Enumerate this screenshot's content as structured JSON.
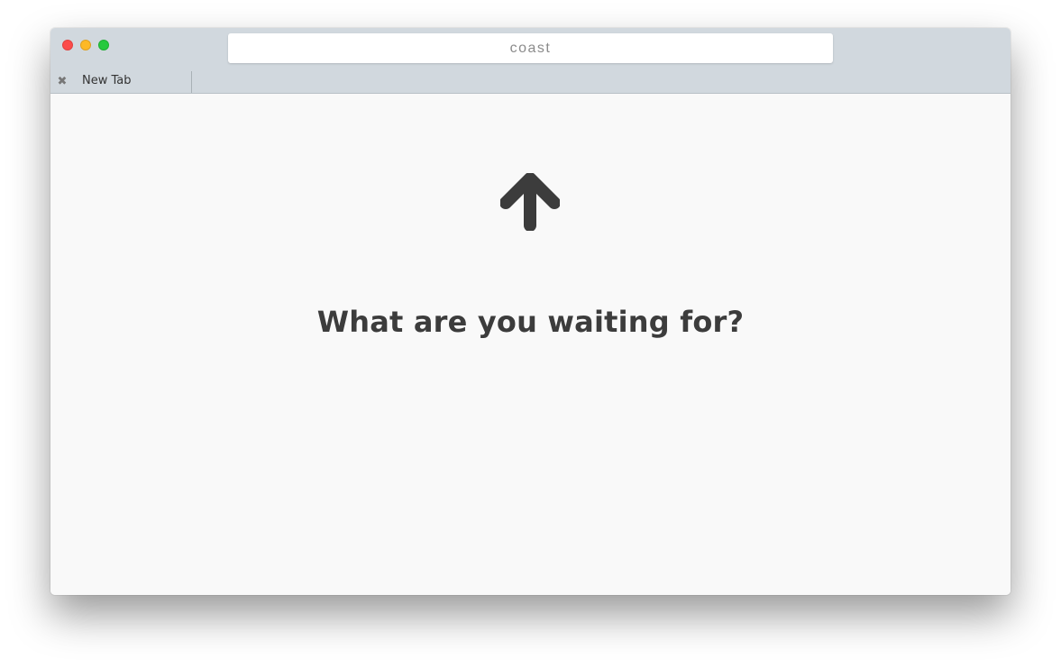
{
  "window": {
    "address_bar": "coast",
    "traffic_lights": [
      "close",
      "minimize",
      "maximize"
    ]
  },
  "tabs": [
    {
      "label": "New Tab",
      "close_icon": "close-icon"
    }
  ],
  "content": {
    "icon": "arrow-up-icon",
    "headline": "What are you waiting for?"
  },
  "colors": {
    "titlebar": "#d1d8de",
    "content_bg": "#f9f9f9",
    "text": "#3c3c3c",
    "close": "#fc4b4a",
    "minimize": "#fdb926",
    "maximize": "#27c93f"
  }
}
